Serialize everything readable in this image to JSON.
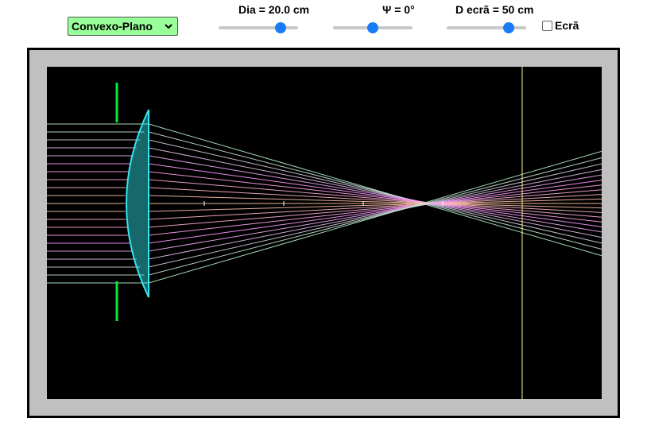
{
  "lens_select": {
    "value": "Convexo-Plano"
  },
  "controls": {
    "dia_label": "Dia = 20.0 cm",
    "psi_label": "Ψ = 0°",
    "dscreen_label": "D ecrã = 50 cm",
    "screen_checkbox_label": "Ecrã",
    "dia_fraction": 0.83,
    "psi_fraction": 0.5,
    "dscreen_fraction": 0.83
  },
  "colors": {
    "select_bg": "#99ff99",
    "slider_thumb": "#1a7cf5",
    "lens": "#33e6ee",
    "aperture": "#00ee33",
    "screen_line": "#fff0a0",
    "ray_edge": "#b5f0c8",
    "ray_mid": "#ff99ff",
    "ray_center": "#ffc89a"
  }
}
